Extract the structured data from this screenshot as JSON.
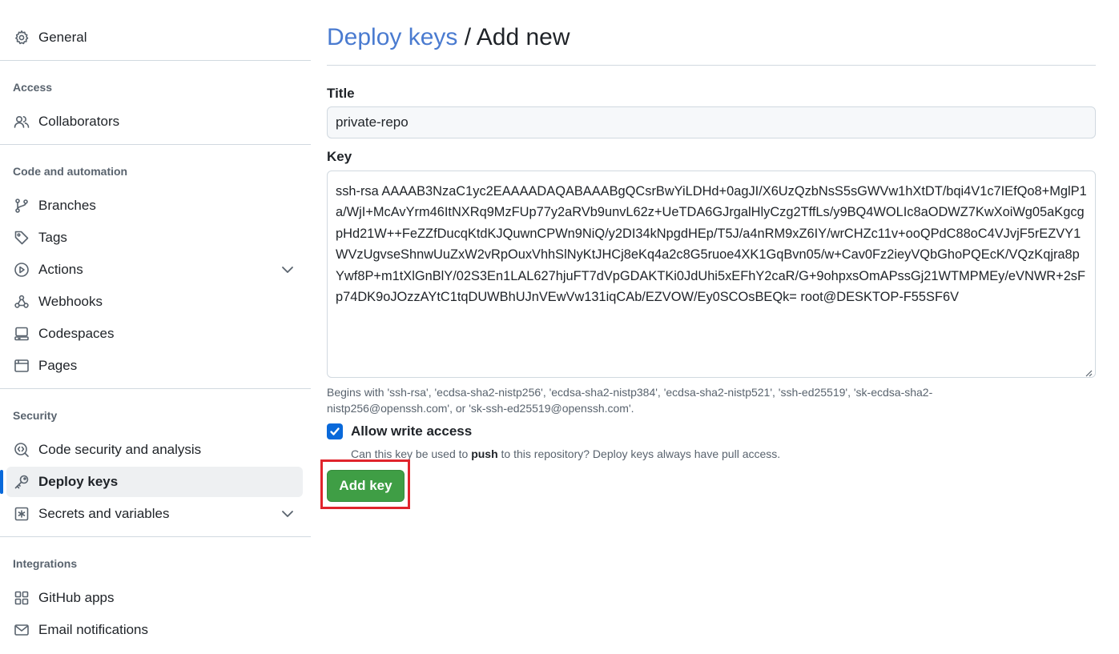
{
  "sidebar": {
    "general": "General",
    "sections": {
      "access": "Access",
      "code_automation": "Code and automation",
      "security": "Security",
      "integrations": "Integrations"
    },
    "items": {
      "collaborators": "Collaborators",
      "branches": "Branches",
      "tags": "Tags",
      "actions": "Actions",
      "webhooks": "Webhooks",
      "codespaces": "Codespaces",
      "pages": "Pages",
      "code_security": "Code security and analysis",
      "deploy_keys": "Deploy keys",
      "secrets": "Secrets and variables",
      "github_apps": "GitHub apps",
      "email_notifications": "Email notifications"
    },
    "selected": "deploy_keys"
  },
  "main": {
    "breadcrumb_link": "Deploy keys",
    "breadcrumb_sep": " / ",
    "breadcrumb_current": "Add new",
    "title_label": "Title",
    "title_value": "private-repo",
    "key_label": "Key",
    "key_value": "ssh-rsa AAAAB3NzaC1yc2EAAAADAQABAAABgQCsrBwYiLDHd+0agJI/X6UzQzbNsS5sGWVw1hXtDT/bqi4V1c7IEfQo8+MglP1a/WjI+McAvYrm46ItNXRq9MzFUp77y2aRVb9unvL62z+UeTDA6GJrgalHlyCzg2TffLs/y9BQ4WOLIc8aODWZ7KwXoiWg05aKgcgpHd21W++FeZZfDucqKtdKJQuwnCPWn9NiQ/y2DI34kNpgdHEp/T5J/a4nRM9xZ6IY/wrCHZc11v+ooQPdC88oC4VJvjF5rEZVY1WVzUgvseShnwUuZxW2vRpOuxVhhSlNyKtJHCj8eKq4a2c8G5ruoe4XK1GqBvn05/w+Cav0Fz2ieyVQbGhoPQEcK/VQzKqjra8pYwf8P+m1tXlGnBlY/02S3En1LAL627hjuFT7dVpGDAKTKi0JdUhi5xEFhY2caR/G+9ohpxsOmAPssGj21WTMPMEy/eVNWR+2sFp74DK9oJOzzAYtC1tqDUWBhUJnVEwVw131iqCAb/EZVOW/Ey0SCOsBEQk= root@DESKTOP-F55SF6V",
    "key_hint": "Begins with 'ssh-rsa', 'ecdsa-sha2-nistp256', 'ecdsa-sha2-nistp384', 'ecdsa-sha2-nistp521', 'ssh-ed25519', 'sk-ecdsa-sha2-nistp256@openssh.com', or 'sk-ssh-ed25519@openssh.com'.",
    "allow_write_label": "Allow write access",
    "allow_write_checked": true,
    "allow_write_desc_pre": "Can this key be used to ",
    "allow_write_desc_bold": "push",
    "allow_write_desc_post": " to this repository? Deploy keys always have pull access.",
    "add_button": "Add key"
  },
  "colors": {
    "accent": "#0969da",
    "breadcrumb_link": "#4a7bd0",
    "primary_button": "#3f9e45",
    "highlight": "#e0242c"
  }
}
